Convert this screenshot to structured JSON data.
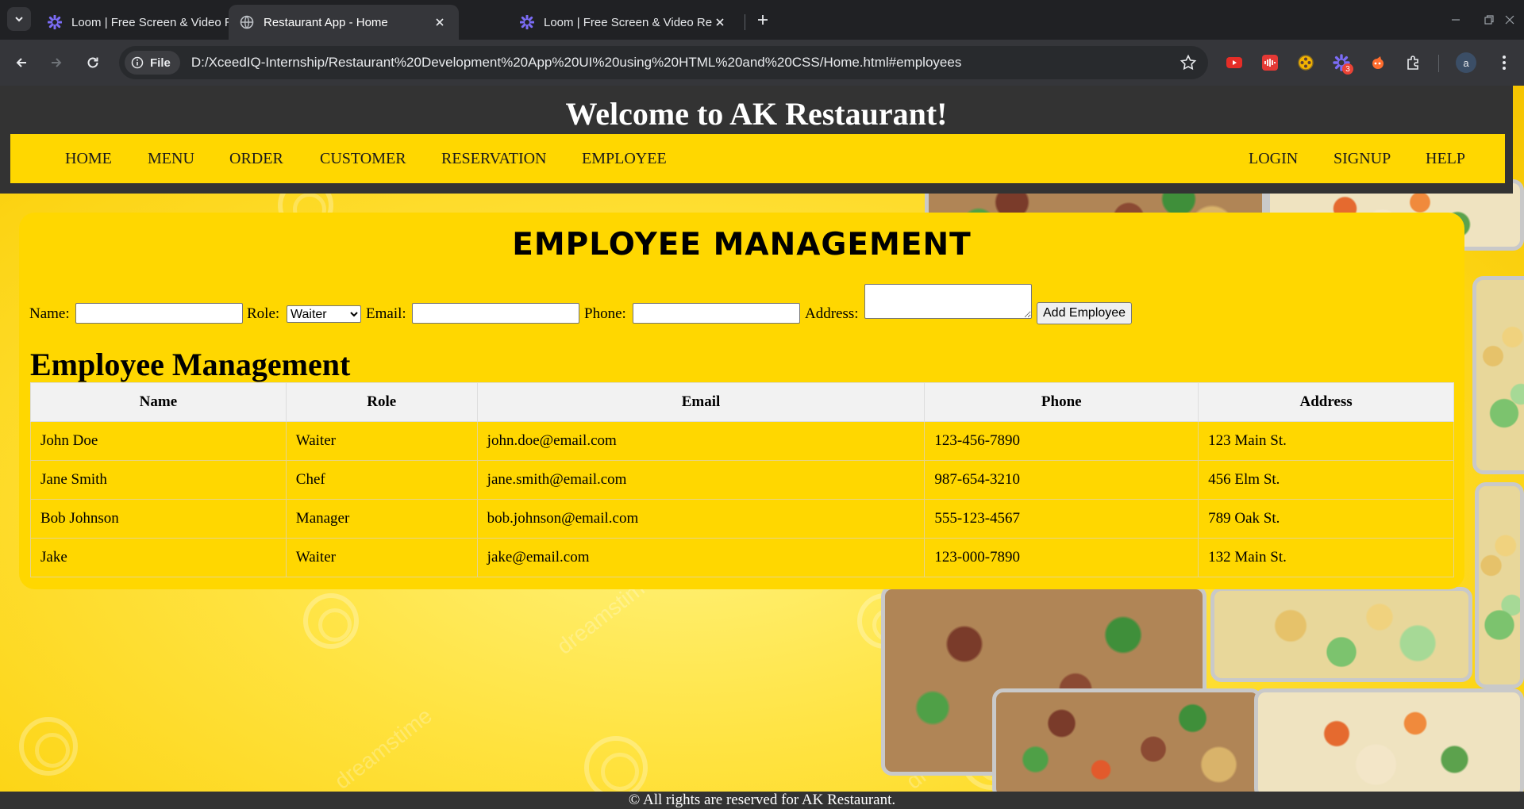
{
  "browser": {
    "tabs": [
      {
        "title": "Loom | Free Screen & Video Recording",
        "icon": "loom-icon"
      },
      {
        "title": "Restaurant App - Home",
        "icon": "globe-icon"
      },
      {
        "title": "Loom | Free Screen & Video Recording",
        "icon": "loom-icon"
      }
    ],
    "site_info_chip": "File",
    "url": "D:/XceedIQ-Internship/Restaurant%20Development%20App%20UI%20using%20HTML%20and%20CSS/Home.html#employees",
    "extensions": [
      "youtube-extension-icon",
      "audio-extension-icon",
      "film-extension-icon",
      "loom-extension-icon",
      "hand-extension-icon",
      "puzzle-icon"
    ],
    "extension_badge": "3",
    "profile_initial": "a"
  },
  "site": {
    "title": "Welcome to AK Restaurant!",
    "nav_left": [
      "HOME",
      "MENU",
      "ORDER",
      "CUSTOMER",
      "RESERVATION",
      "EMPLOYEE"
    ],
    "nav_right": [
      "LOGIN",
      "SIGNUP",
      "HELP"
    ]
  },
  "employee_section": {
    "heading": "EMPLOYEE MANAGEMENT",
    "form": {
      "name_label": "Name:",
      "name_value": "",
      "role_label": "Role:",
      "role_selected": "Waiter",
      "email_label": "Email:",
      "email_value": "",
      "phone_label": "Phone:",
      "phone_value": "",
      "address_label": "Address:",
      "address_value": "",
      "add_button": "Add Employee"
    },
    "table_heading": "Employee Management",
    "columns": [
      "Name",
      "Role",
      "Email",
      "Phone",
      "Address"
    ],
    "rows": [
      [
        "John Doe",
        "Waiter",
        "john.doe@email.com",
        "123-456-7890",
        "123 Main St."
      ],
      [
        "Jane Smith",
        "Chef",
        "jane.smith@email.com",
        "987-654-3210",
        "456 Elm St."
      ],
      [
        "Bob Johnson",
        "Manager",
        "bob.johnson@email.com",
        "555-123-4567",
        "789 Oak St."
      ],
      [
        "Jake",
        "Waiter",
        "jake@email.com",
        "123-000-7890",
        "132 Main St."
      ]
    ]
  },
  "footer": "© All rights are reserved for AK Restaurant.",
  "colors": {
    "nav_yellow": "#ffd700",
    "header_dark": "#333333",
    "browser_dark": "#202124"
  }
}
